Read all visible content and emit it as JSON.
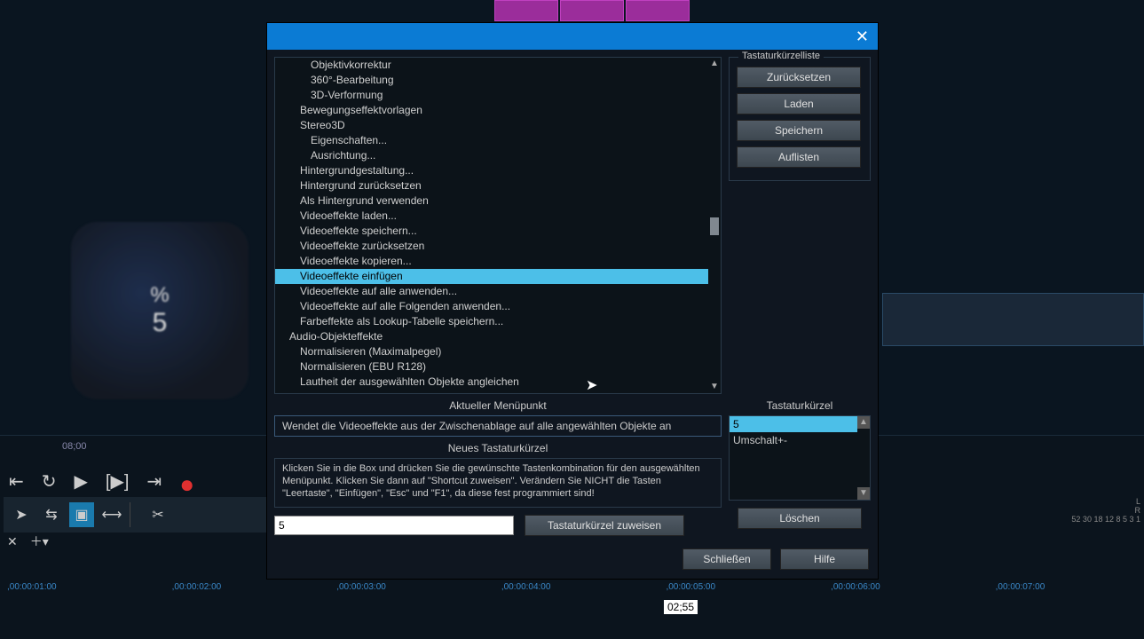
{
  "bg": {
    "key_pct": "%",
    "key_num": "5",
    "ruler": "08;00",
    "timecodes": [
      ",00:00:01:00",
      ",00:00:02:00",
      ",00:00:03:00",
      ",00:00:04:00",
      ",00:00:05:00",
      ",00:00:06:00",
      ",00:00:07:00"
    ],
    "meter_l": "L",
    "meter_r": "R",
    "meter_nums": "52  30  18  12  8  5  3  1",
    "overlay_time": "02;55"
  },
  "dialog": {
    "tree": [
      {
        "lvl": 2,
        "label": "Objektivkorrektur"
      },
      {
        "lvl": 2,
        "label": "360°-Bearbeitung"
      },
      {
        "lvl": 2,
        "label": "3D-Verformung"
      },
      {
        "lvl": 1,
        "label": "Bewegungseffektvorlagen"
      },
      {
        "lvl": 1,
        "label": "Stereo3D"
      },
      {
        "lvl": 2,
        "label": "Eigenschaften..."
      },
      {
        "lvl": 2,
        "label": "Ausrichtung..."
      },
      {
        "lvl": 1,
        "label": "Hintergrundgestaltung..."
      },
      {
        "lvl": 1,
        "label": "Hintergrund zurücksetzen"
      },
      {
        "lvl": 1,
        "label": "Als Hintergrund verwenden"
      },
      {
        "lvl": 1,
        "label": "Videoeffekte laden..."
      },
      {
        "lvl": 1,
        "label": "Videoeffekte speichern..."
      },
      {
        "lvl": 1,
        "label": "Videoeffekte zurücksetzen"
      },
      {
        "lvl": 1,
        "label": "Videoeffekte kopieren..."
      },
      {
        "lvl": 1,
        "label": "Videoeffekte einfügen",
        "selected": true
      },
      {
        "lvl": 1,
        "label": "Videoeffekte auf alle anwenden..."
      },
      {
        "lvl": 1,
        "label": "Videoeffekte auf alle Folgenden anwenden..."
      },
      {
        "lvl": 1,
        "label": "Farbeffekte als Lookup-Tabelle speichern..."
      },
      {
        "lvl": 0,
        "label": "Audio-Objekteffekte"
      },
      {
        "lvl": 1,
        "label": "Normalisieren (Maximalpegel)"
      },
      {
        "lvl": 1,
        "label": "Normalisieren (EBU R128)"
      },
      {
        "lvl": 1,
        "label": "Lautheit der ausgewählten Objekte angleichen"
      }
    ],
    "side": {
      "group_title": "Tastaturkürzelliste",
      "reset": "Zurücksetzen",
      "load": "Laden",
      "save": "Speichern",
      "list": "Auflisten"
    },
    "current_menu_label": "Aktueller Menüpunkt",
    "current_menu_desc": "Wendet die Videoeffekte aus der Zwischenablage auf alle angewählten Objekte an",
    "new_shortcut_label": "Neues Tastaturkürzel",
    "instructions": "Klicken Sie in die Box und drücken Sie die gewünschte Tastenkombination für den ausgewählten Menüpunkt. Klicken Sie dann auf \"Shortcut zuweisen\". Verändern Sie NICHT die Tasten \"Leertaste\", \"Einfügen\", \"Esc\" und \"F1\", da diese fest programmiert sind!",
    "shortcut_value": "5",
    "assign_btn": "Tastaturkürzel zuweisen",
    "shortcut_list_label": "Tastaturkürzel",
    "shortcut_list": [
      {
        "label": "5",
        "selected": true
      },
      {
        "label": "Umschalt+-"
      }
    ],
    "delete_btn": "Löschen",
    "close_btn": "Schließen",
    "help_btn": "Hilfe"
  }
}
